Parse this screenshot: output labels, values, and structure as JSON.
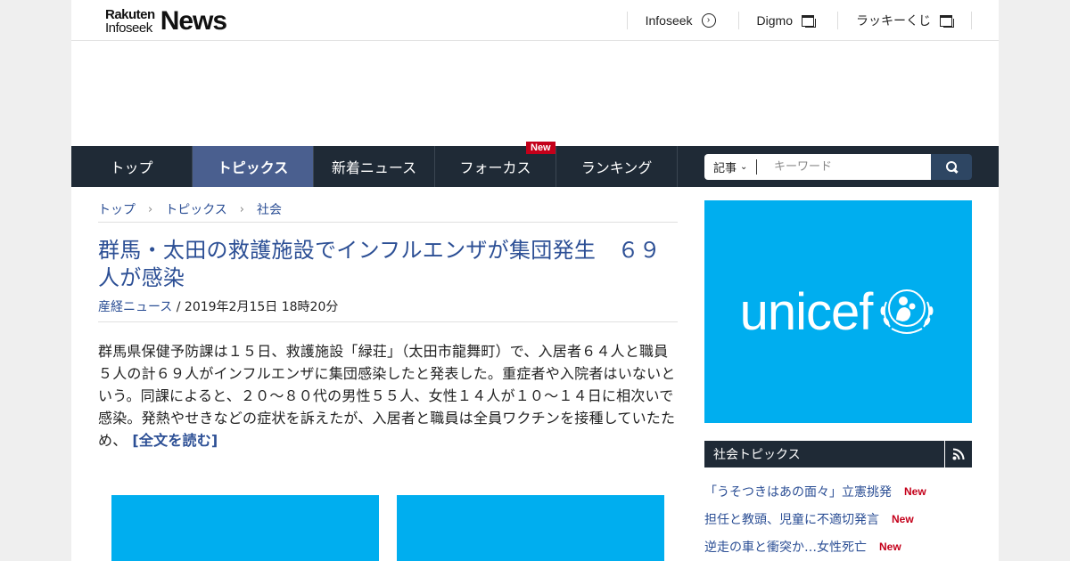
{
  "header": {
    "logo_top": "Rakuten",
    "logo_bottom": "Infoseek",
    "logo_news": "News",
    "links": [
      {
        "label": "Infoseek",
        "icon": "circle-arrow-icon"
      },
      {
        "label": "Digmo",
        "icon": "external-window-icon"
      },
      {
        "label": "ラッキーくじ",
        "icon": "external-window-icon"
      }
    ]
  },
  "nav": {
    "items": [
      {
        "label": "トップ",
        "active": false
      },
      {
        "label": "トピックス",
        "active": true
      },
      {
        "label": "新着ニュース",
        "active": false
      },
      {
        "label": "フォーカス",
        "active": false,
        "badge": "New"
      },
      {
        "label": "ランキング",
        "active": false
      }
    ],
    "search": {
      "category": "記事",
      "placeholder": "キーワード"
    }
  },
  "breadcrumb": [
    "トップ",
    "トピックス",
    "社会"
  ],
  "article": {
    "title": "群馬・太田の救護施設でインフルエンザが集団発生　６９人が感染",
    "source": "産経ニュース",
    "date": " / 2019年2月15日 18時20分",
    "body": "群馬県保健予防課は１５日、救護施設「緑荘」（太田市龍舞町）で、入居者６４人と職員５人の計６９人がインフルエンザに集団感染したと発表した。重症者や入院者はいないという。同課によると、２０～８０代の男性５５人、女性１４人が１０～１４日に相次いで感染。発熱やせきなどの症状を訴えたが、入居者と職員は全員ワクチンを接種していたため、",
    "read_more": "[全文を読む]"
  },
  "sidebar": {
    "ad_text": "unicef",
    "section_title": "社会トピックス",
    "topics": [
      {
        "label": "「うそつきはあの面々」立憲挑発",
        "badge": "New"
      },
      {
        "label": "担任と教頭、児童に不適切発言",
        "badge": "New"
      },
      {
        "label": "逆走の車と衝突か…女性死亡",
        "badge": "New"
      }
    ]
  },
  "colors": {
    "nav_bg": "#1f2a36",
    "nav_active": "#4a5f8f",
    "link": "#2c4f95",
    "badge_red": "#c4001a",
    "ad_blue": "#00aeef"
  }
}
